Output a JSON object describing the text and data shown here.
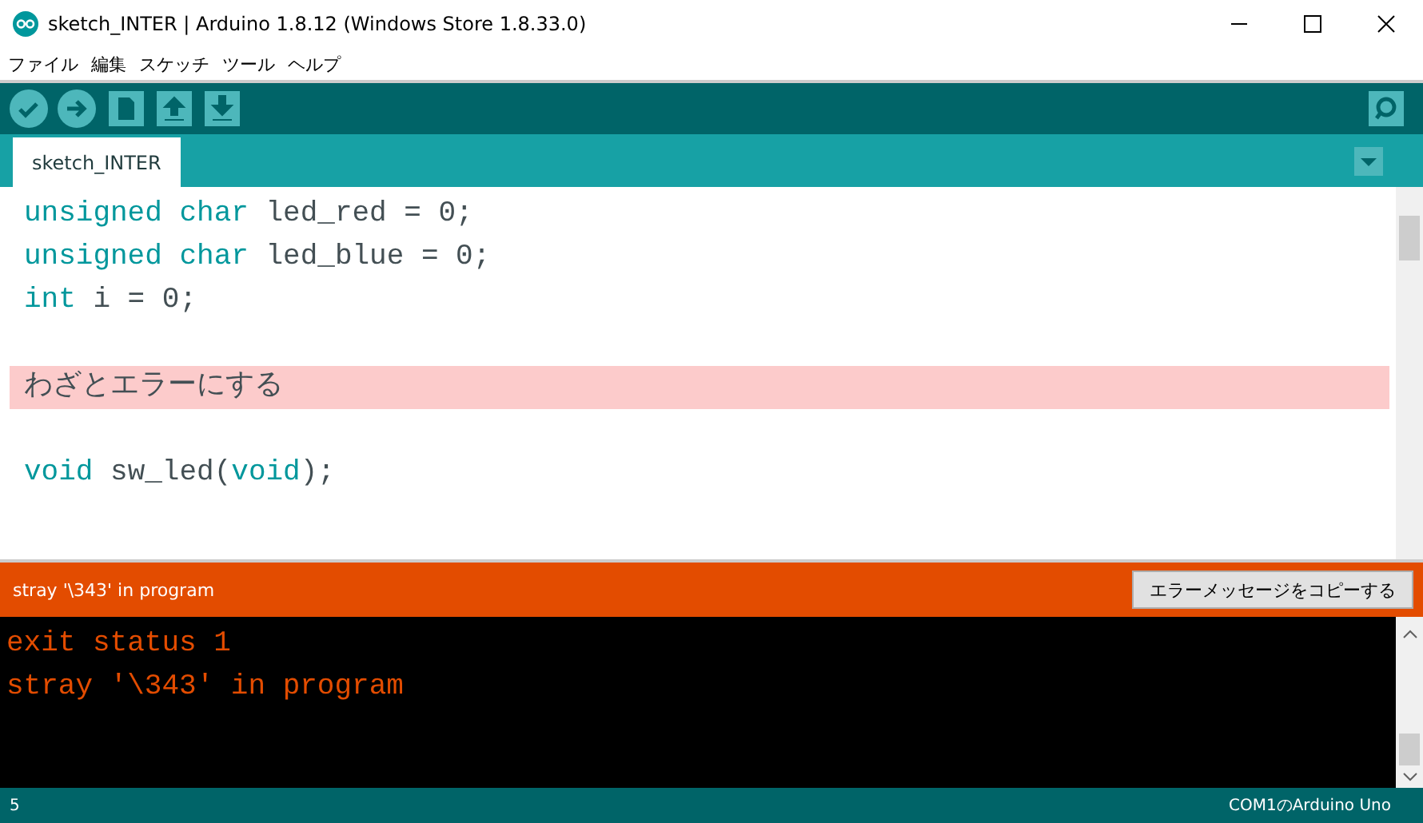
{
  "window": {
    "title": "sketch_INTER | Arduino 1.8.12 (Windows Store 1.8.33.0)"
  },
  "menu": [
    "ファイル",
    "編集",
    "スケッチ",
    "ツール",
    "ヘルプ"
  ],
  "toolbar": {
    "buttons": [
      {
        "kind": "verify"
      },
      {
        "kind": "upload"
      },
      {
        "kind": "new"
      },
      {
        "kind": "open"
      },
      {
        "kind": "save"
      }
    ]
  },
  "tabs": [
    {
      "label": "sketch_INTER",
      "selected": true
    }
  ],
  "editor": {
    "lines": [
      {
        "kind": "code",
        "highlighted": false,
        "tokens": [
          {
            "kind": "keyword",
            "text": "unsigned"
          },
          {
            "kind": "keyword",
            "text": " char"
          },
          {
            "kind": "plain",
            "text": " led_red = 0;"
          }
        ]
      },
      {
        "kind": "code",
        "highlighted": false,
        "tokens": [
          {
            "kind": "keyword",
            "text": "unsigned"
          },
          {
            "kind": "keyword",
            "text": " char"
          },
          {
            "kind": "plain",
            "text": " led_blue = 0;"
          }
        ]
      },
      {
        "kind": "code",
        "highlighted": false,
        "tokens": [
          {
            "kind": "keyword",
            "text": "int"
          },
          {
            "kind": "plain",
            "text": " i = 0;"
          }
        ]
      },
      {
        "kind": "blank"
      },
      {
        "kind": "code",
        "highlighted": true,
        "tokens": [
          {
            "kind": "plain",
            "text": "わざとエラーにする"
          }
        ]
      },
      {
        "kind": "blank"
      },
      {
        "kind": "code",
        "highlighted": false,
        "tokens": [
          {
            "kind": "keyword",
            "text": "void"
          },
          {
            "kind": "plain",
            "text": " sw_led("
          },
          {
            "kind": "keyword",
            "text": "void"
          },
          {
            "kind": "plain",
            "text": ");"
          }
        ]
      }
    ]
  },
  "message_bar": {
    "text": "stray '\\343' in program",
    "copy_button": "エラーメッセージをコピーする"
  },
  "console": {
    "lines": [
      "exit status 1",
      "stray '\\343' in program"
    ]
  },
  "status_bar": {
    "line": "5",
    "board": "COM1のArduino Uno"
  }
}
